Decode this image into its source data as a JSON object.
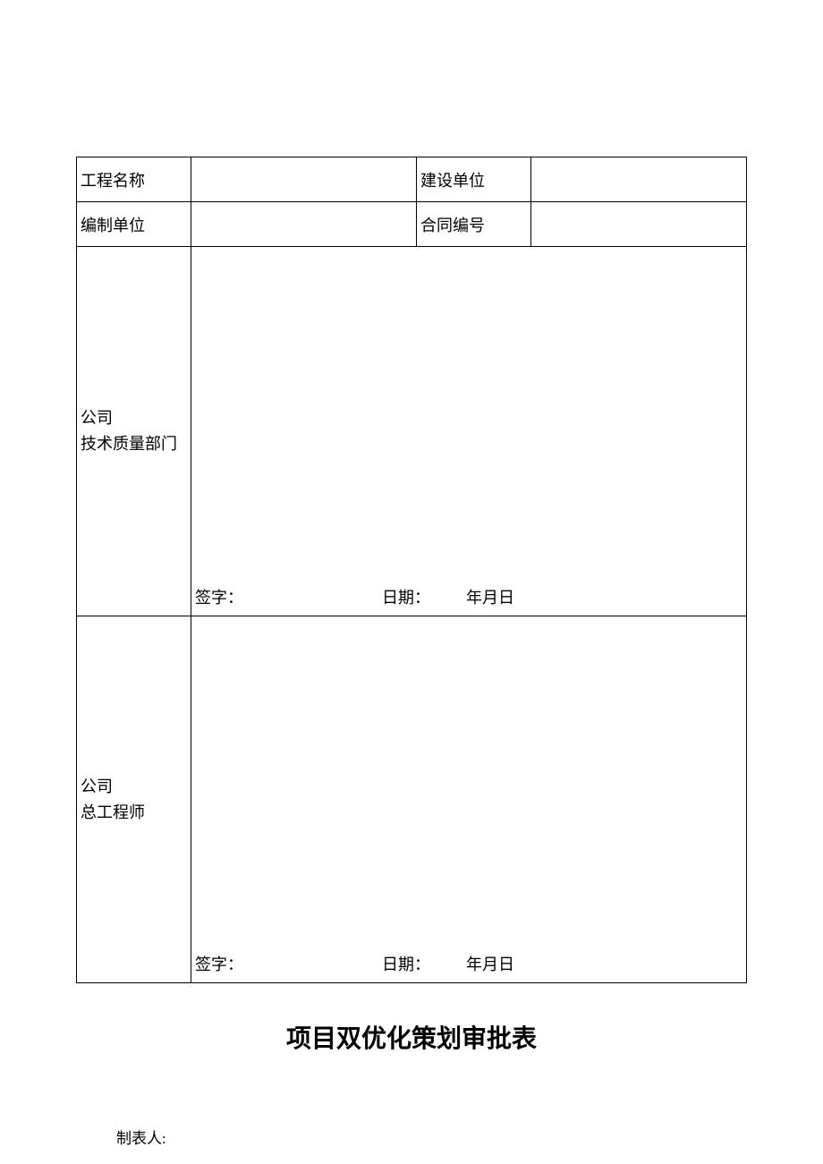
{
  "table": {
    "row1": {
      "label1": "工程名称",
      "value1": "",
      "label2": "建设单位",
      "value2": ""
    },
    "row2": {
      "label1": "编制单位",
      "value1": "",
      "label2": "合同编号",
      "value2": ""
    },
    "section1": {
      "label_line1": "公司",
      "label_line2": "技术质量部门",
      "signature_label": "签字：",
      "date_label": "日期：",
      "date_ymd": "年月日"
    },
    "section2": {
      "label_line1": "公司",
      "label_line2": "总工程师",
      "signature_label": "签字：",
      "date_label": "日期：",
      "date_ymd": "年月日"
    }
  },
  "title": "项目双优化策划审批表",
  "footer": {
    "preparer_label": "制表人:"
  }
}
